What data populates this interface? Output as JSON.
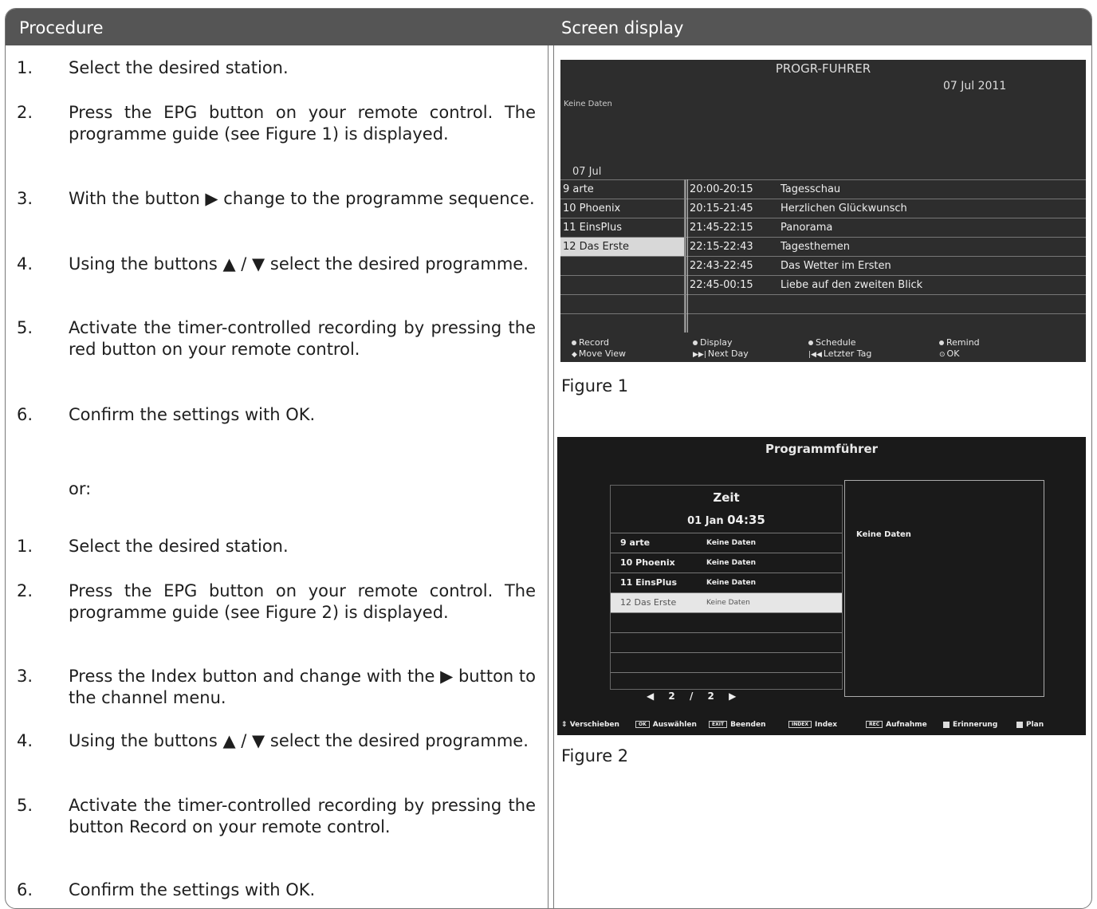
{
  "header": {
    "procedure": "Procedure",
    "screen_display": "Screen display"
  },
  "steps_a": [
    {
      "num": "1.",
      "text": "Select the desired station."
    },
    {
      "num": "2.",
      "text": "Press the EPG button on your remote control. The programme guide (see Figure 1) is displayed."
    },
    {
      "num": "3.",
      "text": "With the button ▶ change to the programme sequence."
    },
    {
      "num": "4.",
      "text": "Using the buttons ▲ / ▼ select the desired programme."
    },
    {
      "num": "5.",
      "text": "Activate the timer-controlled recording by pressing the red button on your remote control."
    },
    {
      "num": "6.",
      "text": "Confirm the settings with OK."
    }
  ],
  "or": "or:",
  "steps_b": [
    {
      "num": "1.",
      "text": "Select the desired station."
    },
    {
      "num": "2.",
      "text": "Press the EPG button on your remote control. The programme guide (see Figure 2) is displayed."
    },
    {
      "num": "3.",
      "text": "Press the Index button and change with the ▶ button to the channel menu."
    },
    {
      "num": "4.",
      "text": "Using the buttons ▲ / ▼ select the desired programme."
    },
    {
      "num": "5.",
      "text": "Activate the timer-controlled recording by pressing the button Record on your remote control."
    },
    {
      "num": "6.",
      "text": "Confirm the settings with OK."
    }
  ],
  "figure1": {
    "caption": "Figure 1",
    "title": "PROGR-FUHRER",
    "date": "07 Jul 2011",
    "info": "Keine Daten",
    "day": "07 Jul",
    "rows": [
      {
        "channel": "9 arte",
        "time": "20:00-20:15",
        "programme": "Tagesschau"
      },
      {
        "channel": "10 Phoenix",
        "time": "20:15-21:45",
        "programme": "Herzlichen Glückwunsch"
      },
      {
        "channel": "11 EinsPlus",
        "time": "21:45-22:15",
        "programme": "Panorama"
      },
      {
        "channel": "12 Das Erste",
        "time": "22:15-22:43",
        "programme": "Tagesthemen"
      },
      {
        "channel": "",
        "time": "22:43-22:45",
        "programme": "Das Wetter im Ersten"
      },
      {
        "channel": "",
        "time": "22:45-00:15",
        "programme": "Liebe auf den zweiten Blick"
      },
      {
        "channel": "",
        "time": "",
        "programme": ""
      },
      {
        "channel": "",
        "time": "",
        "programme": ""
      }
    ],
    "legend": {
      "record": "Record",
      "display": "Display",
      "schedule": "Schedule",
      "remind": "Remind",
      "move_view": "Move View",
      "next_day": "Next Day",
      "letzter_tag": "Letzter Tag",
      "ok": "OK"
    }
  },
  "figure2": {
    "caption": "Figure 2",
    "title": "Programmführer",
    "zeit": "Zeit",
    "date": "01 Jan",
    "time": "04:35",
    "info": "Keine Daten",
    "rows": [
      {
        "channel": "9 arte",
        "status": "Keine Daten"
      },
      {
        "channel": "10 Phoenix",
        "status": "Keine Daten"
      },
      {
        "channel": "11 EinsPlus",
        "status": "Keine Daten"
      },
      {
        "channel": "12 Das Erste",
        "status": "Keine Daten"
      },
      {
        "channel": "",
        "status": ""
      },
      {
        "channel": "",
        "status": ""
      },
      {
        "channel": "",
        "status": ""
      },
      {
        "channel": "",
        "status": ""
      }
    ],
    "page_current": "2",
    "page_sep": "/",
    "page_total": "2",
    "legend": {
      "verschieben": "Verschieben",
      "ok_key": "OK",
      "auswaehlen": "Auswählen",
      "exit_key": "EXIT",
      "beenden": "Beenden",
      "index_key": "INDEX",
      "index": "Index",
      "rec_key": "REC",
      "aufnahme": "Aufnahme",
      "erinnerung": "Erinnerung",
      "plan": "Plan"
    }
  }
}
